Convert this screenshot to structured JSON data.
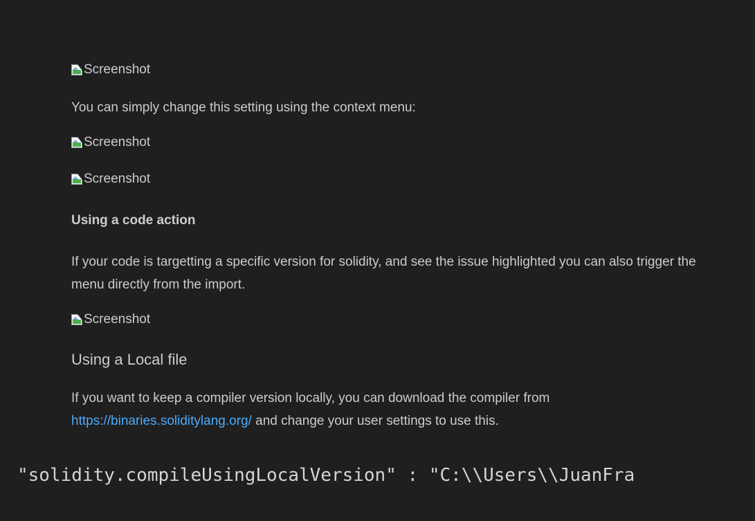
{
  "content": {
    "image_alt_1": "Screenshot",
    "context_menu_text": "You can simply change this setting using the context menu:",
    "image_alt_2": "Screenshot",
    "image_alt_3": "Screenshot",
    "heading_code_action": "Using a code action",
    "code_action_text": "If your code is targetting a specific version for solidity, and see the issue highlighted you can also trigger the menu directly from the import.",
    "image_alt_4": "Screenshot",
    "heading_local_file": "Using a Local file",
    "local_file_text_before": "If you want to keep a compiler version locally, you can download the compiler from",
    "local_file_link": "https://binaries.soliditylang.org/",
    "local_file_text_after": " and change your user settings to use this.",
    "code_line": "\"solidity.compileUsingLocalVersion\" : \"C:\\\\Users\\\\JuanFra"
  },
  "colors": {
    "background": "#1f1f1f",
    "text": "#cccccc",
    "link": "#4daafc"
  }
}
